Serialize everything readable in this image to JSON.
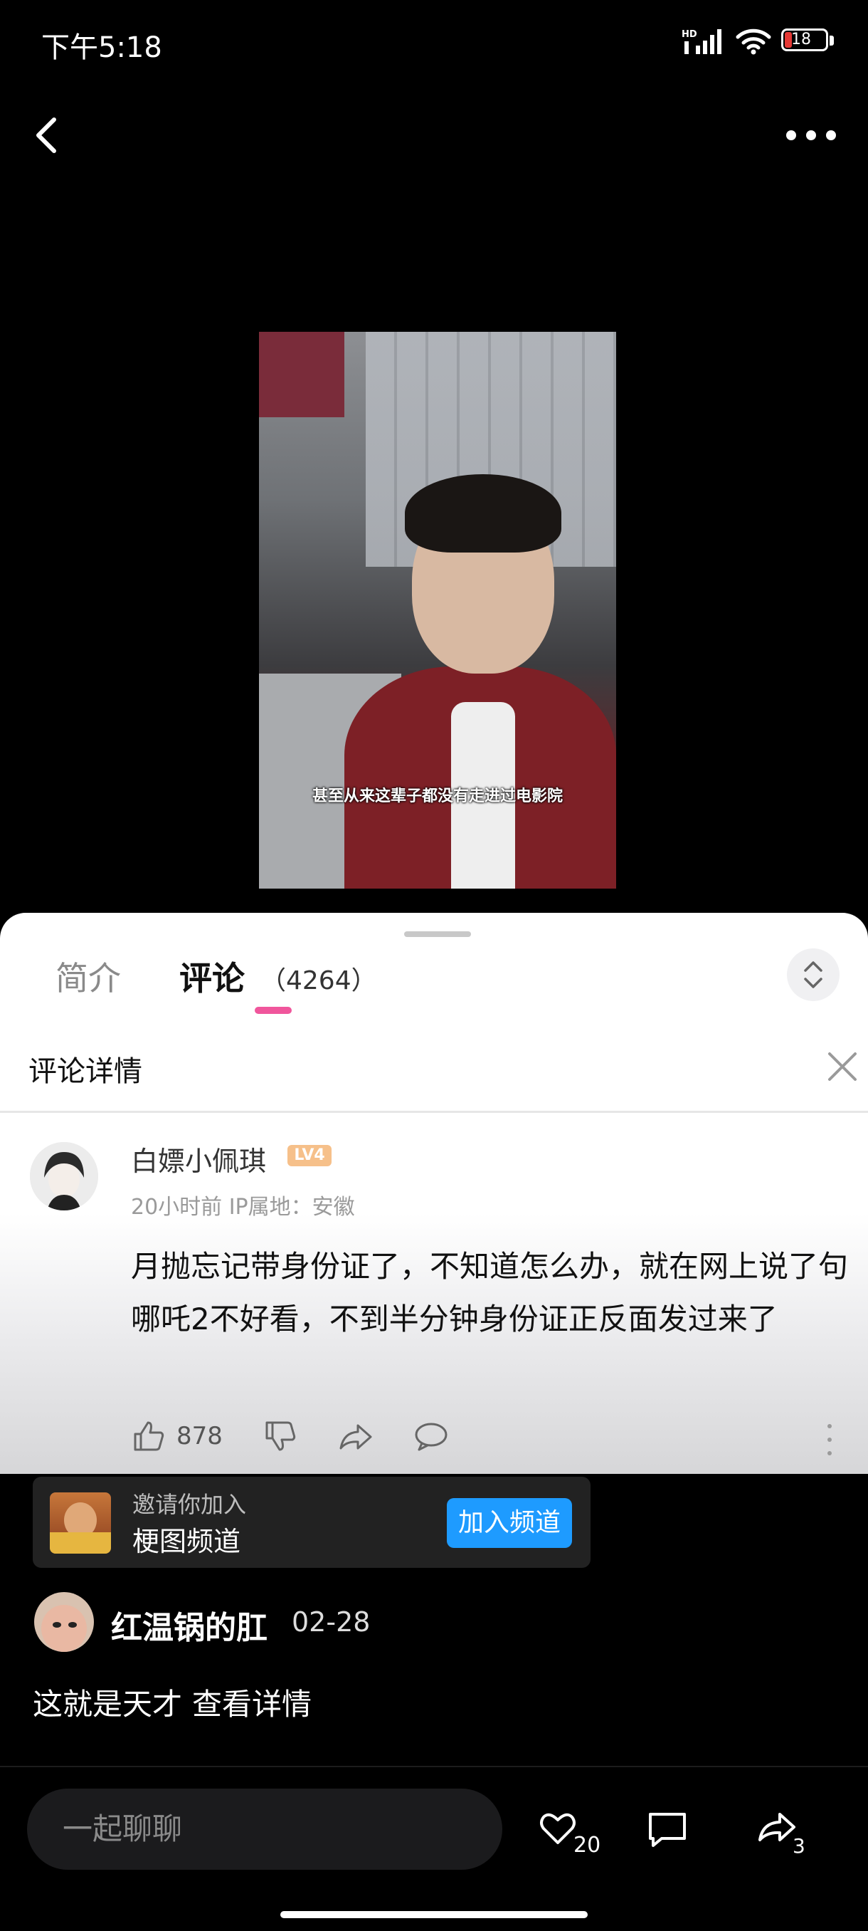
{
  "status_bar": {
    "time": "下午5:18",
    "battery": "18"
  },
  "video": {
    "caption": "甚至从来这辈子都没有走进过电影院"
  },
  "panel": {
    "tabs": [
      {
        "label": "简介"
      },
      {
        "label": "评论",
        "count": "（4264）"
      }
    ],
    "detail_title": "评论详情"
  },
  "comment": {
    "username": "白嫖小佩琪",
    "level": "LV4",
    "meta": "20小时前 IP属地：安徽",
    "content": "月抛忘记带身份证了，不知道怎么办，就在网上说了句哪吒2不好看，不到半分钟身份证正反面发过来了",
    "likes": "878"
  },
  "channel_invite": {
    "subtitle": "邀请你加入",
    "title": "梗图频道",
    "button": "加入频道"
  },
  "danmaku_comment": {
    "username": "红温锅的肛",
    "date": "02-28",
    "content": "这就是天才",
    "link": "查看详情"
  },
  "bottom_bar": {
    "input_placeholder": "一起聊聊",
    "like_count": "20",
    "share_count": "3"
  },
  "colors": {
    "accent_pink": "#f0569c",
    "join_blue": "#1e9bff",
    "level_orange": "#f6c08a"
  }
}
